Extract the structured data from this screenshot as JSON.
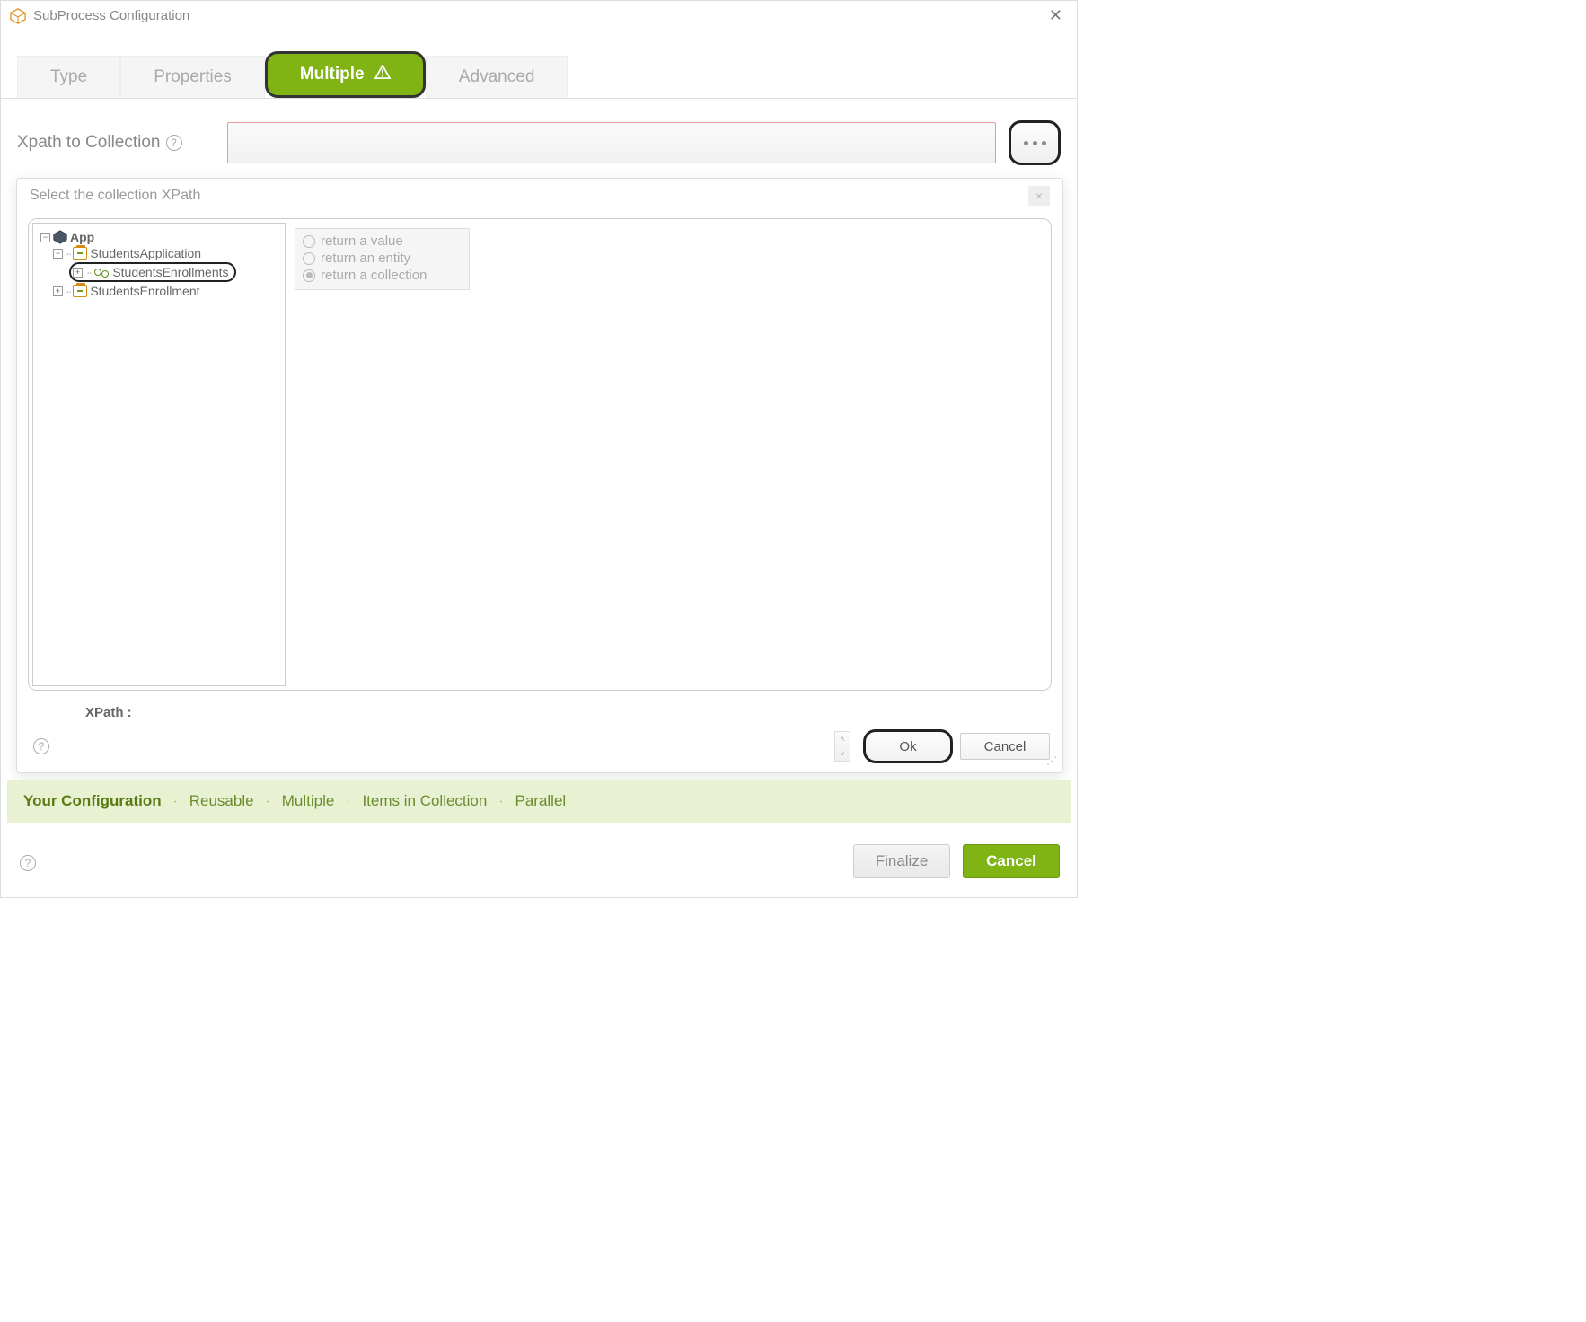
{
  "window": {
    "title": "SubProcess Configuration"
  },
  "tabs": {
    "type": "Type",
    "properties": "Properties",
    "multiple": "Multiple",
    "advanced": "Advanced"
  },
  "xpath_row": {
    "label": "Xpath to Collection"
  },
  "dialog": {
    "title": "Select the collection XPath",
    "tree": {
      "root": "App",
      "node1": "StudentsApplication",
      "node2": "StudentsEnrollments",
      "node3": "StudentsEnrollment"
    },
    "radios": {
      "r1": "return a value",
      "r2": "return an entity",
      "r3": "return a collection"
    },
    "xpath_label": "XPath :",
    "ok": "Ok",
    "cancel": "Cancel"
  },
  "config_strip": {
    "label": "Your Configuration",
    "reusable": "Reusable",
    "multiple": "Multiple",
    "items": "Items in Collection",
    "parallel": "Parallel"
  },
  "bottom": {
    "finalize": "Finalize",
    "cancel": "Cancel"
  }
}
